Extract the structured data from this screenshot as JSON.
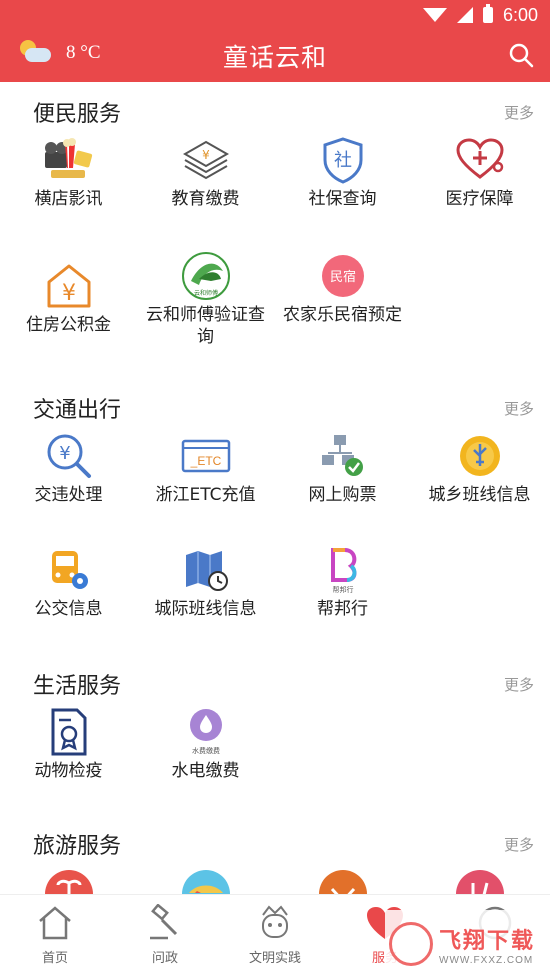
{
  "status_bar": {
    "time": "6:00"
  },
  "header": {
    "temperature": "8 °C",
    "title": "童话云和",
    "weather_icon": "partly-cloudy-icon",
    "search_icon": "search-icon"
  },
  "sections": [
    {
      "title": "便民服务",
      "more": "更多",
      "items": [
        {
          "label": "横店影讯",
          "icon": "movie-icon"
        },
        {
          "label": "教育缴费",
          "icon": "yen-stack-icon"
        },
        {
          "label": "社保查询",
          "icon": "shield-she-icon"
        },
        {
          "label": "医疗保障",
          "icon": "heart-medical-icon"
        },
        {
          "label": "住房公积金",
          "icon": "house-yen-icon"
        },
        {
          "label": "云和师傅验证查询",
          "icon": "craftsman-logo-icon"
        },
        {
          "label": "农家乐民宿预定",
          "icon": "minsu-icon"
        }
      ]
    },
    {
      "title": "交通出行",
      "more": "更多",
      "items": [
        {
          "label": "交违处理",
          "icon": "violation-search-icon"
        },
        {
          "label": "浙江ETC充值",
          "icon": "etc-card-icon"
        },
        {
          "label": "网上购票",
          "icon": "ticket-network-icon"
        },
        {
          "label": "城乡班线信息",
          "icon": "route-coin-icon"
        },
        {
          "label": "公交信息",
          "icon": "bus-gear-icon"
        },
        {
          "label": "城际班线信息",
          "icon": "map-clock-icon"
        },
        {
          "label": "帮邦行",
          "icon": "bangbangxing-logo-icon"
        }
      ]
    },
    {
      "title": "生活服务",
      "more": "更多",
      "items": [
        {
          "label": "动物检疫",
          "icon": "certificate-icon"
        },
        {
          "label": "水电缴费",
          "icon": "water-drop-icon"
        }
      ]
    },
    {
      "title": "旅游服务",
      "more": "更多",
      "items": [
        {
          "label": "",
          "icon": "palm-island-icon"
        },
        {
          "label": "",
          "icon": "beach-icon"
        },
        {
          "label": "",
          "icon": "emblem-icon"
        },
        {
          "label": "",
          "icon": "food-icon"
        }
      ]
    }
  ],
  "icon_texts": {
    "etc": "_ETC",
    "minsu": "民宿",
    "water_small": "水费缴费",
    "bangbang_small": "帮邦行",
    "yunhe_small": "云和师傅"
  },
  "tabs": [
    {
      "label": "首页",
      "icon": "home-icon"
    },
    {
      "label": "问政",
      "icon": "gavel-icon"
    },
    {
      "label": "文明实践",
      "icon": "mascot-icon"
    },
    {
      "label": "服务",
      "icon": "heart-icon"
    },
    {
      "label": "",
      "icon": "circle-icon"
    }
  ],
  "watermark": {
    "text": "飞翔下载",
    "url": "WWW.FXXZ.COM"
  },
  "colors": {
    "brand_red": "#e9484a",
    "icon_blue": "#4a79c8"
  }
}
